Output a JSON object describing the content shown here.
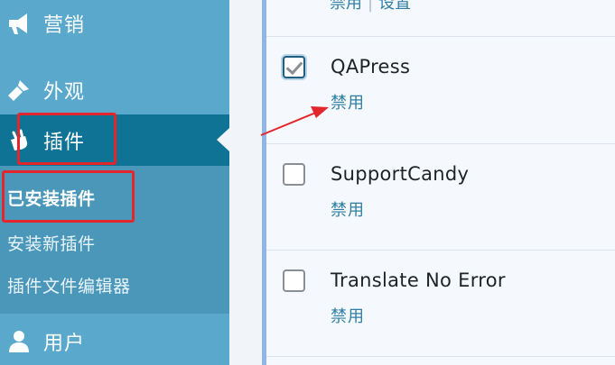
{
  "sidebar": {
    "menu": {
      "marketing": {
        "label": "营销",
        "icon": "megaphone-icon"
      },
      "appearance": {
        "label": "外观",
        "icon": "paintbrush-icon"
      },
      "plugins": {
        "label": "插件",
        "icon": "plug-icon"
      },
      "users": {
        "label": "用户",
        "icon": "user-icon"
      }
    },
    "plugins_submenu": {
      "installed": "已安装插件",
      "add_new": "安装新插件",
      "editor": "插件文件编辑器"
    }
  },
  "plugin_list": {
    "top_actions": {
      "first": "禁用",
      "second": "设置"
    },
    "plugins": [
      {
        "name": "QAPress",
        "action": "禁用",
        "checked": true
      },
      {
        "name": "SupportCandy",
        "action": "禁用",
        "checked": false
      },
      {
        "name": "Translate No Error",
        "action": "禁用",
        "checked": false
      }
    ]
  },
  "colors": {
    "sidebar_bg": "#5aa9cc",
    "active_menu_bg": "#0f7395",
    "submenu_bg": "#4a97ba",
    "link": "#2f7fa5",
    "annotation_red": "#e3262b"
  }
}
